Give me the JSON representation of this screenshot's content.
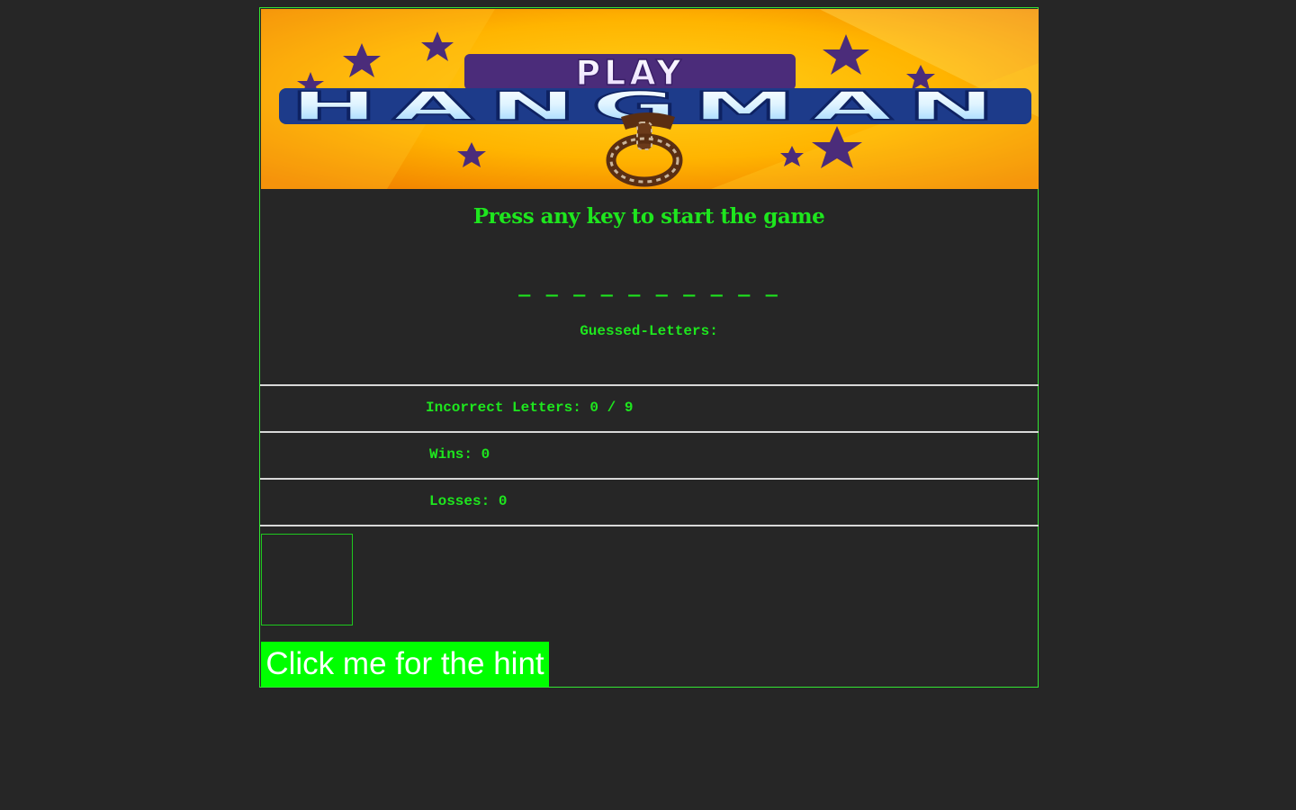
{
  "banner": {
    "play_text": "PLAY",
    "hangman_text": "HANGMAN"
  },
  "game": {
    "prompt": "Press any key to start the game",
    "word_blanks": "_ _ _ _ _ _ _ _ _ _",
    "guessed_letters_label": "Guessed-Letters:"
  },
  "stats": {
    "incorrect": "Incorrect Letters: 0 / 9",
    "wins": "Wins: 0",
    "losses": "Losses: 0"
  },
  "hint": {
    "button_label": "Click me for the hint"
  },
  "colors": {
    "background": "#262626",
    "accent_green": "#1ee61e",
    "button_green": "#00ff00",
    "divider": "#d8d8d8"
  }
}
